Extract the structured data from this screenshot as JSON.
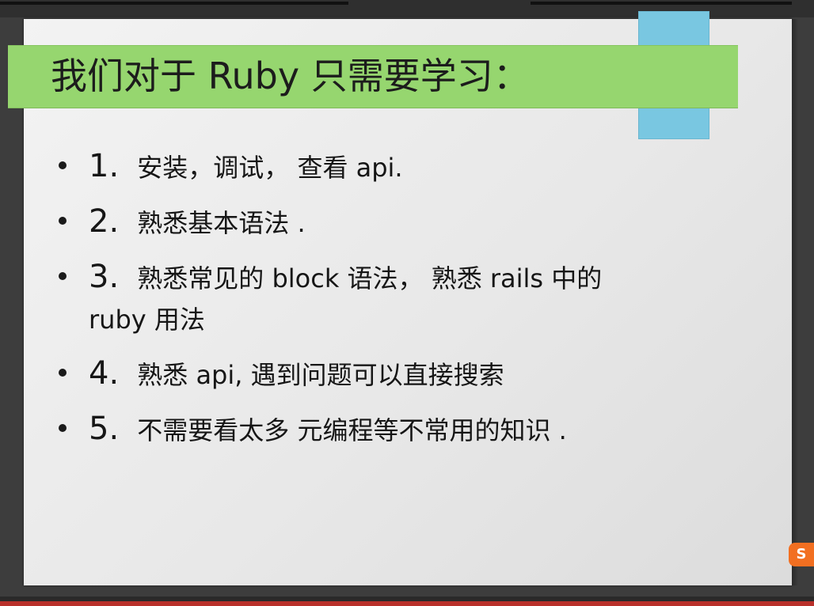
{
  "slide": {
    "title": "我们对于 Ruby 只需要学习：",
    "items": [
      {
        "num": "1.",
        "text": "安装，调试， 查看 api."
      },
      {
        "num": "2.",
        "text": "熟悉基本语法 ."
      },
      {
        "num": "3.",
        "text": "熟悉常见的 block  语法， 熟悉 rails 中的",
        "text2": "ruby 用法"
      },
      {
        "num": "4.",
        "text": "熟悉 api,  遇到问题可以直接搜索"
      },
      {
        "num": "5.",
        "text": "不需要看太多 元编程等不常用的知识 ."
      }
    ]
  },
  "logo": {
    "label": "S"
  },
  "colors": {
    "title_bar": "#96d66f",
    "accent_block": "#79c7e1",
    "logo": "#f26f21"
  }
}
